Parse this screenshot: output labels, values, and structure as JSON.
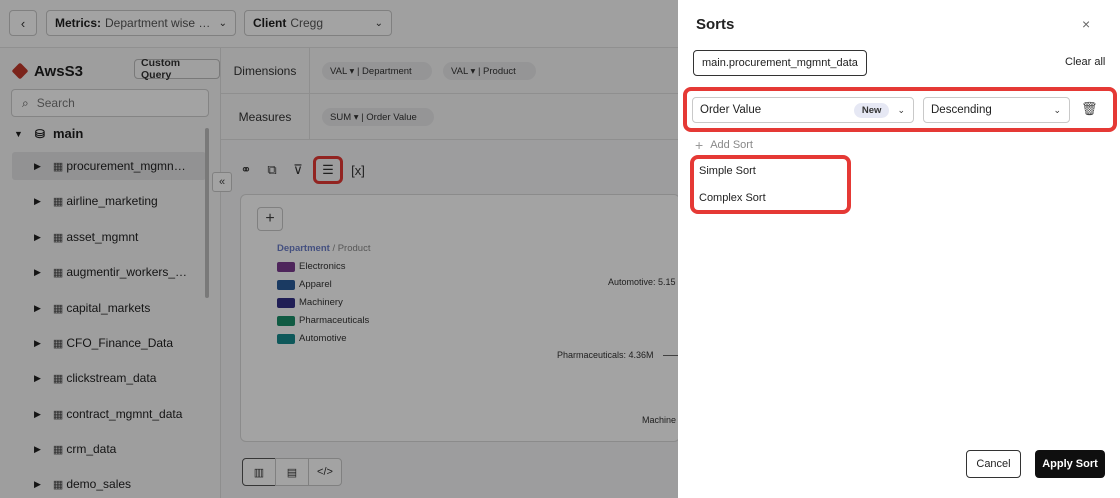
{
  "topbar": {
    "back_icon": "chevron-left-icon",
    "metrics_label": "Metrics:",
    "metrics_value": "Department wise or...",
    "client_label": "Client",
    "client_value": "Cregg"
  },
  "sidebar": {
    "source_name": "AwsS3",
    "custom_query_label": "Custom Query",
    "search_placeholder": "Search",
    "db_name": "main",
    "tables": [
      "procurement_mgmnt_...",
      "airline_marketing",
      "asset_mgmnt",
      "augmentir_workers_da...",
      "capital_markets",
      "CFO_Finance_Data",
      "clickstream_data",
      "contract_mgmnt_data",
      "crm_data",
      "demo_sales"
    ]
  },
  "main": {
    "dimensions_label": "Dimensions",
    "dimension_pills": [
      "VAL ▾ | Department",
      "VAL ▾ | Product"
    ],
    "measures_label": "Measures",
    "measure_pills": [
      "SUM ▾ | Order Value"
    ],
    "toolbar_var_label": "[x]",
    "legend_dept": "Department",
    "legend_sep": "/ Product",
    "legend_items": [
      {
        "label": "Electronics",
        "color": "#7a3a8f"
      },
      {
        "label": "Apparel",
        "color": "#2a5c9a"
      },
      {
        "label": "Machinery",
        "color": "#332f86"
      },
      {
        "label": "Pharmaceuticals",
        "color": "#1a8f6a"
      },
      {
        "label": "Automotive",
        "color": "#168a8e"
      }
    ],
    "chart_labels": [
      "Automotive: 5.15",
      "Pharmaceuticals: 4.36M",
      "Machine"
    ]
  },
  "sorts_panel": {
    "title": "Sorts",
    "table_chip": "main.procurement_mgmnt_data",
    "clear_all": "Clear all",
    "field_value": "Order Value",
    "field_badge": "New",
    "direction_value": "Descending",
    "add_sort_label": "Add Sort",
    "menu_items": [
      "Simple Sort",
      "Complex Sort"
    ],
    "cancel_label": "Cancel",
    "apply_label": "Apply Sort"
  },
  "colors": {
    "highlight": "#e53935",
    "primary_button": "#0f0f0f"
  }
}
